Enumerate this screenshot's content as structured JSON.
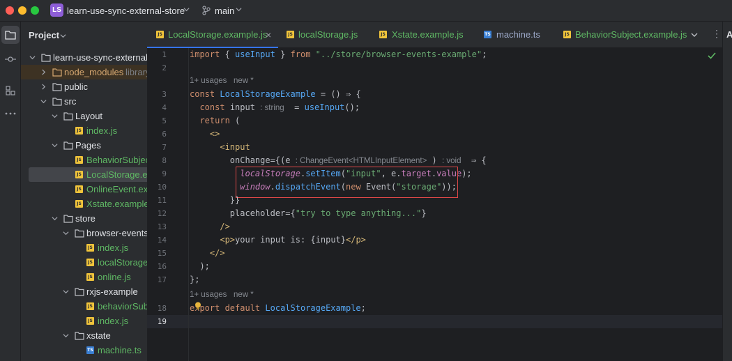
{
  "window": {
    "project_badge": "LS",
    "project_name": "learn-use-sync-external-store",
    "branch": "main"
  },
  "project_panel": {
    "title": "Project",
    "tree": [
      {
        "label": "learn-use-sync-external",
        "kind": "folder",
        "open": true
      },
      {
        "label": "node_modules",
        "kind": "folder-lib",
        "open": false,
        "extra": "library"
      },
      {
        "label": "public",
        "kind": "folder",
        "open": false
      },
      {
        "label": "src",
        "kind": "folder",
        "open": true
      },
      {
        "label": "Layout",
        "kind": "folder",
        "open": true
      },
      {
        "label": "index.js",
        "kind": "js"
      },
      {
        "label": "Pages",
        "kind": "folder",
        "open": true
      },
      {
        "label": "BehaviorSubject",
        "kind": "js"
      },
      {
        "label": "LocalStorage.ex",
        "kind": "js",
        "selected": true
      },
      {
        "label": "OnlineEvent.exa",
        "kind": "js"
      },
      {
        "label": "Xstate.example.",
        "kind": "js"
      },
      {
        "label": "store",
        "kind": "folder",
        "open": true
      },
      {
        "label": "browser-events",
        "kind": "folder",
        "open": true
      },
      {
        "label": "index.js",
        "kind": "js"
      },
      {
        "label": "localStorage.",
        "kind": "js"
      },
      {
        "label": "online.js",
        "kind": "js"
      },
      {
        "label": "rxjs-example",
        "kind": "folder",
        "open": true
      },
      {
        "label": "behaviorSubj",
        "kind": "js"
      },
      {
        "label": "index.js",
        "kind": "js"
      },
      {
        "label": "xstate",
        "kind": "folder",
        "open": true
      },
      {
        "label": "machine.ts",
        "kind": "ts"
      }
    ]
  },
  "tabs": [
    {
      "label": "LocalStorage.example.js",
      "type": "js",
      "active": true
    },
    {
      "label": "localStorage.js",
      "type": "js"
    },
    {
      "label": "Xstate.example.js",
      "type": "js"
    },
    {
      "label": "machine.ts",
      "type": "ts"
    },
    {
      "label": "BehaviorSubject.example.js",
      "type": "js"
    }
  ],
  "right_strip_label": "A",
  "editor": {
    "usages_hint_1": "1+ usages   new *",
    "usages_hint_2": "1+ usages   new *",
    "line_numbers": [
      "1",
      "2",
      "3",
      "4",
      "5",
      "6",
      "7",
      "8",
      "9",
      "10",
      "11",
      "12",
      "13",
      "14",
      "15",
      "16",
      "17",
      "18",
      "19"
    ],
    "inlay_string": ": string",
    "inlay_event": ": ChangeEvent<HTMLInputElement>",
    "inlay_void": ": void",
    "lines": {
      "l1_import": "import",
      "l1_brace_open": " { ",
      "l1_name": "useInput",
      "l1_brace_close": " } ",
      "l1_from": "from",
      "l1_path": " \"../store/browser-events-example\"",
      "l1_semi": ";",
      "l3_const": "const ",
      "l3_name": "LocalStorageExample",
      "l3_rest": " = () ⇒ {",
      "l4_const": "const ",
      "l4_var": "input",
      "l4_eq": "  = ",
      "l4_call": "useInput",
      "l4_end": "();",
      "l5_return": "return",
      "l5_paren": " (",
      "l6_frag": "<>",
      "l7_tag": "<input",
      "l8_attr": "onChange",
      "l8_open": "={(e",
      "l8_close": " )",
      "l8_arrow": "  ⇒ {",
      "l9_obj": "localStorage",
      "l9_dot": ".",
      "l9_method": "setItem",
      "l9_open": "(",
      "l9_key": "\"input\"",
      "l9_mid": ", e.",
      "l9_target": "target",
      "l9_dot2": ".",
      "l9_value": "value",
      "l9_end": ");",
      "l10_obj": "window",
      "l10_dot": ".",
      "l10_method": "dispatchEvent",
      "l10_open": "(",
      "l10_new": "new ",
      "l10_event": "Event",
      "l10_open2": "(",
      "l10_str": "\"storage\"",
      "l10_end": "));",
      "l11": "}}",
      "l12_attr": "placeholder",
      "l12_eq": "={",
      "l12_str": "\"try to type anything...\"",
      "l12_end": "}",
      "l13": "/>",
      "l14_open": "<p>",
      "l14_text": "your input is: {input}",
      "l14_close": "</p>",
      "l15": "</>",
      "l16": ");",
      "l17": "};",
      "l18_export": "export",
      "l18_default": " default ",
      "l18_name": "LocalStorageExample",
      "l18_semi": ";"
    }
  },
  "colors": {
    "accent": "#3574f0",
    "keyword": "#cf8e6d",
    "string": "#6aab73",
    "function": "#56a8f5",
    "tag": "#d5b778",
    "highlight_box": "#e04848"
  }
}
